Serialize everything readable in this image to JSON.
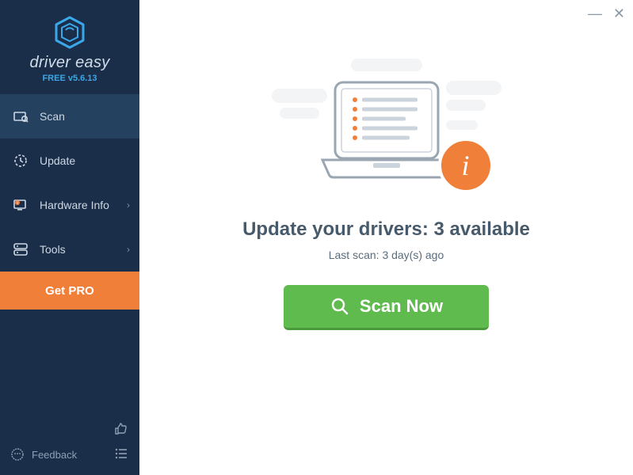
{
  "app": {
    "name": "driver easy",
    "version": "FREE v5.6.13"
  },
  "sidebar": {
    "items": [
      {
        "label": "Scan",
        "icon": "scan",
        "active": true,
        "arrow": false
      },
      {
        "label": "Update",
        "icon": "update",
        "active": false,
        "arrow": false
      },
      {
        "label": "Hardware Info",
        "icon": "hardware",
        "active": false,
        "arrow": true
      },
      {
        "label": "Tools",
        "icon": "tools",
        "active": false,
        "arrow": true
      }
    ],
    "get_pro": "Get PRO",
    "feedback": "Feedback"
  },
  "main": {
    "headline": "Update your drivers: 3 available",
    "subline": "Last scan: 3 day(s) ago",
    "scan_button": "Scan Now"
  }
}
